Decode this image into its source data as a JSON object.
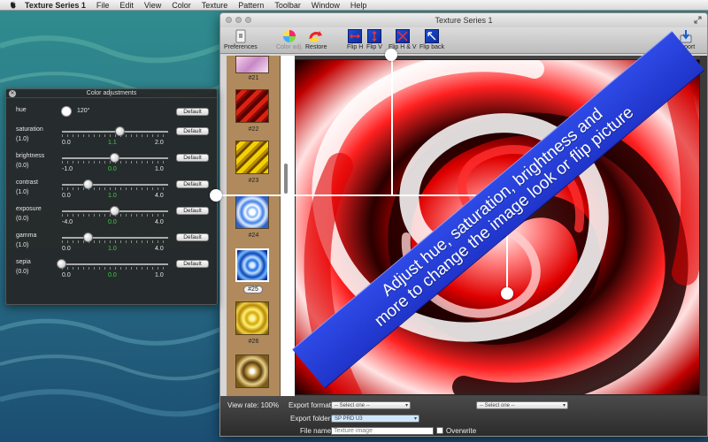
{
  "menubar": {
    "app_name": "Texture Series 1",
    "items": [
      "File",
      "Edit",
      "View",
      "Color",
      "Texture",
      "Pattern",
      "Toolbar",
      "Window",
      "Help"
    ]
  },
  "window": {
    "title": "Texture Series 1"
  },
  "toolbar": {
    "preferences": "Preferences",
    "color_adj": "Color adj.",
    "restore": "Restore",
    "flip_h": "Flip H",
    "flip_v": "Flip V",
    "flip_hv": "Flip H & V",
    "flip_back": "Flip back",
    "export": "Export"
  },
  "thumbnails": [
    {
      "label": "#21"
    },
    {
      "label": "#22"
    },
    {
      "label": "#23"
    },
    {
      "label": "#24"
    },
    {
      "label": "#25",
      "selected": true
    },
    {
      "label": "#26"
    }
  ],
  "export_panel": {
    "view_rate_label": "View rate: 100%",
    "export_format_label": "Export format:",
    "export_format_value": "-- Select one --",
    "second_select_value": "-- Select one --",
    "export_folder_label": "Export folder:",
    "export_folder_value": "SP PRD U3",
    "file_name_label": "File name:",
    "file_name_placeholder": "Texture image",
    "overwrite_label": "Overwrite"
  },
  "color_panel": {
    "title": "Color adjustments",
    "default_label": "Default",
    "hue": {
      "name": "hue",
      "value": "120°"
    },
    "sliders": [
      {
        "name": "saturation",
        "paren": "(1.0)",
        "min": "0.0",
        "cur": "1.1",
        "max": "2.0",
        "level": 0.55
      },
      {
        "name": "brightness",
        "paren": "(0.0)",
        "min": "-1.0",
        "cur": "0.0",
        "max": "1.0",
        "level": 0.5
      },
      {
        "name": "contrast",
        "paren": "(1.0)",
        "min": "0.0",
        "cur": "1.0",
        "max": "4.0",
        "level": 0.25
      },
      {
        "name": "exposure",
        "paren": "(0.0)",
        "min": "-4.0",
        "cur": "0.0",
        "max": "4.0",
        "level": 0.5
      },
      {
        "name": "gamma",
        "paren": "(1.0)",
        "min": "0.0",
        "cur": "1.0",
        "max": "4.0",
        "level": 0.25
      },
      {
        "name": "sepia",
        "paren": "(0.0)",
        "min": "0.0",
        "cur": "0.0",
        "max": "1.0",
        "level": 0.0
      }
    ]
  },
  "banner": {
    "line1": "Adjust hue, saturation, brightness and",
    "line2": "more to change the image look or flip picture"
  },
  "colors": {
    "banner_blue": "#2438d8",
    "swirl_red": "#e00000",
    "slider_value_green": "#3fd03f",
    "strip_brown": "#b08a5c"
  }
}
